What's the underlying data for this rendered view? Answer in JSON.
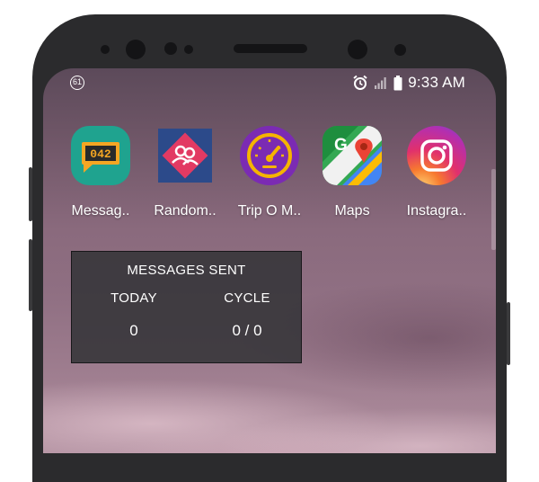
{
  "status": {
    "notification_badge": "61",
    "time": "9:33 AM",
    "icons": [
      "alarm-icon",
      "signal-icon",
      "battery-icon"
    ]
  },
  "apps": [
    {
      "label": "Messag..",
      "icon": "message-counter-app-icon",
      "badge_text": "042"
    },
    {
      "label": "Random..",
      "icon": "random-chat-app-icon"
    },
    {
      "label": "Trip O M..",
      "icon": "speedometer-app-icon"
    },
    {
      "label": "Maps",
      "icon": "maps-app-icon",
      "badge_text": "G"
    },
    {
      "label": "Instagra..",
      "icon": "instagram-app-icon"
    }
  ],
  "widget": {
    "title": "MESSAGES SENT",
    "today_label": "TODAY",
    "today_value": "0",
    "cycle_label": "CYCLE",
    "cycle_value": "0 / 0"
  },
  "colors": {
    "phone_frame": "#2b2b2d",
    "widget_bg": "#343438",
    "messages_icon": "#1fa38f",
    "random_icon": "#e23a63",
    "trip_icon": "#7b2bb3",
    "maps_green": "#34a853",
    "maps_blue": "#4285f4",
    "maps_red": "#ea4335",
    "maps_yellow": "#fbbc05"
  }
}
